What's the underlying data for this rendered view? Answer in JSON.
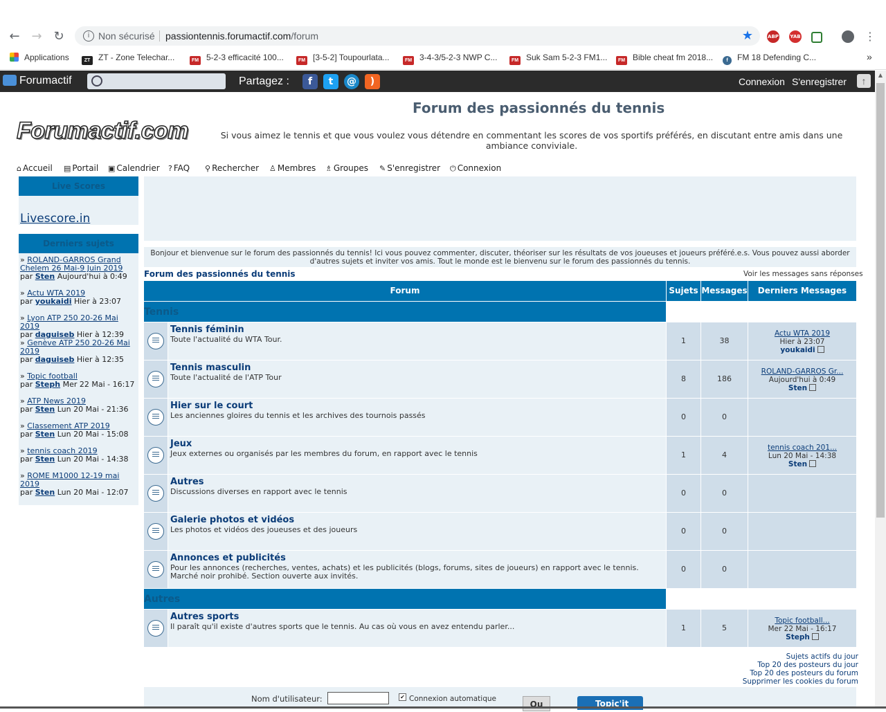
{
  "browser": {
    "security": "Non sécurisé",
    "url_host": "passiontennis.forumactif.com",
    "url_path": "/forum",
    "bookmarks": [
      {
        "label": "Applications",
        "icon": "apps-grid-icon"
      },
      {
        "label": "ZT - Zone Telechar...",
        "icon": "zt-icon"
      },
      {
        "label": "5-2-3 efficacité 100...",
        "icon": "fm-icon"
      },
      {
        "label": "[3-5-2] Toupourlata...",
        "icon": "fm-icon"
      },
      {
        "label": "3-4-3/5-2-3 NWP C...",
        "icon": "fm-icon"
      },
      {
        "label": "Suk Sam 5-2-3 FM1...",
        "icon": "fm-icon"
      },
      {
        "label": "Bible cheat fm 2018...",
        "icon": "fm-icon"
      },
      {
        "label": "FM 18 Defending C...",
        "icon": "globe-icon"
      }
    ],
    "more": "»"
  },
  "fa_bar": {
    "logo": "Forumactif",
    "share_label": "Partagez :",
    "login": "Connexion",
    "register": "S'enregistrer"
  },
  "header": {
    "title": "Forum des passionnés du tennis",
    "logo_text": "Forumactif.com",
    "description": "Si vous aimez le tennis et que vous voulez vous détendre en commentant les scores de vos sportifs préférés, en discutant entre amis dans une ambiance conviviale."
  },
  "nav": [
    {
      "label": "Accueil",
      "icon": "home-icon"
    },
    {
      "label": "Portail",
      "icon": "portal-icon"
    },
    {
      "label": "Calendrier",
      "icon": "calendar-icon"
    },
    {
      "label": "FAQ",
      "icon": "faq-icon"
    },
    {
      "label": "Rechercher",
      "icon": "search-icon"
    },
    {
      "label": "Membres",
      "icon": "member-icon"
    },
    {
      "label": "Groupes",
      "icon": "groups-icon"
    },
    {
      "label": "S'enregistrer",
      "icon": "register-icon"
    },
    {
      "label": "Connexion",
      "icon": "power-icon"
    }
  ],
  "sidebar": {
    "live_title": "Live Scores",
    "live_link": "Livescore.in",
    "recent_title": "Derniers sujets",
    "topics": [
      {
        "title": "ROLAND-GARROS Grand Chelem 26 Mai-9 Juin 2019",
        "by": "par",
        "author": "Sten",
        "when": "Aujourd'hui à 0:49"
      },
      {
        "title": "Actu WTA 2019",
        "by": "par",
        "author": "youkaidi",
        "when": "Hier à 23:07"
      },
      {
        "title": "Lyon ATP 250 20-26 Mai 2019",
        "by": "par",
        "author": "daguiseb",
        "when": "Hier à 12:39"
      },
      {
        "title": "Genève ATP 250 20-26 Mai 2019",
        "by": "par",
        "author": "daguiseb",
        "when": "Hier à 12:35"
      },
      {
        "title": "Topic football",
        "by": "par",
        "author": "Steph",
        "when": "Mer 22 Mai - 16:17"
      },
      {
        "title": "ATP News 2019",
        "by": "par",
        "author": "Sten",
        "when": "Lun 20 Mai - 21:36"
      },
      {
        "title": "Classement ATP 2019",
        "by": "par",
        "author": "Sten",
        "when": "Lun 20 Mai - 15:08"
      },
      {
        "title": "tennis coach 2019",
        "by": "par",
        "author": "Sten",
        "when": "Lun 20 Mai - 14:38"
      },
      {
        "title": "ROME M1000 12-19 mai 2019",
        "by": "par",
        "author": "Sten",
        "when": "Lun 20 Mai - 12:07"
      }
    ]
  },
  "content": {
    "welcome": "Bonjour et bienvenue sur le forum des passionnés du tennis! Ici vous pouvez commenter, discuter, théoriser sur les résultats de vos joueuses et joueurs préféré.e.s. Vous pouvez aussi aborder d'autres sujets et inviter vos amis. Tout le monde est le bienvenu sur le forum des passionnés du tennis.",
    "breadcrumb": "Forum des passionnés du tennis",
    "unanswered": "Voir les messages sans réponses",
    "columns": {
      "forum": "Forum",
      "topics": "Sujets",
      "posts": "Messages",
      "last": "Derniers Messages"
    },
    "categories": [
      {
        "name": "Tennis"
      },
      {
        "name": "Autres"
      }
    ],
    "forums": [
      {
        "name": "Tennis féminin",
        "desc": "Toute l'actualité du WTA Tour.",
        "topics": "1",
        "posts": "38",
        "last_title": "Actu WTA 2019",
        "last_when": "Hier à 23:07",
        "last_user": "youkaidi"
      },
      {
        "name": "Tennis masculin",
        "desc": "Toute l'actualité de l'ATP Tour",
        "topics": "8",
        "posts": "186",
        "last_title": "ROLAND-GARROS Gr...",
        "last_when": "Aujourd'hui à 0:49",
        "last_user": "Sten"
      },
      {
        "name": "Hier sur le court",
        "desc": "Les anciennes gloires du tennis et les archives des tournois passés",
        "topics": "0",
        "posts": "0",
        "last_title": "",
        "last_when": "",
        "last_user": ""
      },
      {
        "name": "Jeux",
        "desc": "Jeux externes ou organisés par les membres du forum, en rapport avec le tennis",
        "topics": "1",
        "posts": "4",
        "last_title": "tennis coach 201...",
        "last_when": "Lun 20 Mai - 14:38",
        "last_user": "Sten"
      },
      {
        "name": "Autres",
        "desc": "Discussions diverses en rapport avec le tennis",
        "topics": "0",
        "posts": "0",
        "last_title": "",
        "last_when": "",
        "last_user": ""
      },
      {
        "name": "Galerie photos et vidéos",
        "desc": "Les photos et vidéos des joueuses et des joueurs",
        "topics": "0",
        "posts": "0",
        "last_title": "",
        "last_when": "",
        "last_user": ""
      },
      {
        "name": "Annonces et publicités",
        "desc": "Pour les annonces (recherches, ventes, achats) et les publicités (blogs, forums, sites de joueurs) en rapport avec le tennis. Marché noir prohibé. Section ouverte aux invités.",
        "topics": "0",
        "posts": "0",
        "last_title": "",
        "last_when": "",
        "last_user": ""
      },
      {
        "name": "Autres sports",
        "desc": "Il paraît qu'il existe d'autres sports que le tennis. Au cas où vous en avez entendu parler...",
        "topics": "1",
        "posts": "5",
        "last_title": "Topic football...",
        "last_when": "Mer 22 Mai - 16:17",
        "last_user": "Steph"
      }
    ],
    "footer_links": [
      "Sujets actifs du jour",
      "Top 20 des posteurs du jour",
      "Top 20 des posteurs du forum",
      "Supprimer les cookies du forum"
    ]
  },
  "login": {
    "username_label": "Nom d'utilisateur:",
    "auto_label": "Connexion automatique",
    "or_label": "Ou",
    "topicit": "Topic'it"
  },
  "colors": {
    "accent": "#0073b0",
    "cell_light": "#e9f1f6",
    "cell_dark": "#cfdde9",
    "link": "#0b3c78"
  }
}
